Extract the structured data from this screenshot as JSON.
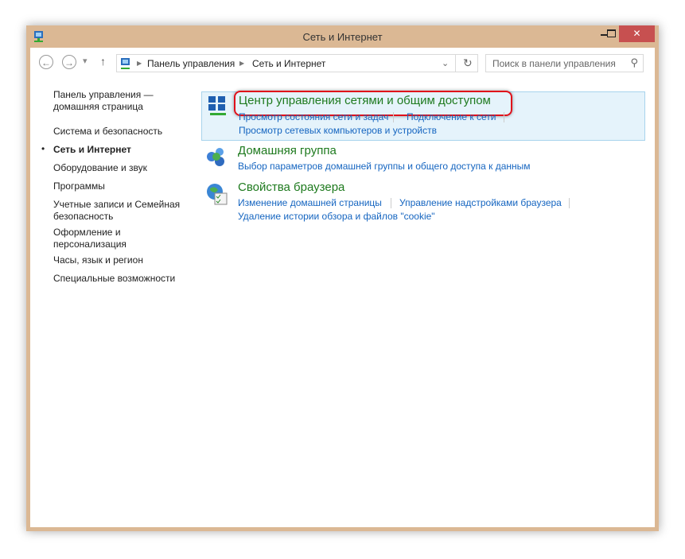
{
  "window": {
    "title": "Сеть и Интернет",
    "close": "✕"
  },
  "nav": {
    "back": "←",
    "forward": "→",
    "up": "↑",
    "dropdown": "▾",
    "refresh": "↻",
    "breadcrumb": [
      "Панель управления",
      "Сеть и Интернет"
    ],
    "search_placeholder": "Поиск в панели управления"
  },
  "sidebar": {
    "home": "Панель управления — домашняя страница",
    "items": [
      "Система и безопасность",
      "Сеть и Интернет",
      "Оборудование и звук",
      "Программы",
      "Учетные записи и Семейная безопасность",
      "Оформление и персонализация",
      "Часы, язык и регион",
      "Специальные возможности"
    ],
    "active": "Сеть и Интернет"
  },
  "categories": [
    {
      "title": "Центр управления сетями и общим доступом",
      "links": [
        "Просмотр состояния сети и задач",
        "Подключение к сети",
        "Просмотр сетевых компьютеров и устройств"
      ]
    },
    {
      "title": "Домашняя группа",
      "links": [
        "Выбор параметров домашней группы и общего доступа к данным"
      ]
    },
    {
      "title": "Свойства браузера",
      "links": [
        "Изменение домашней страницы",
        "Управление надстройками браузера",
        "Удаление истории обзора и файлов \"cookie\""
      ]
    }
  ],
  "colors": {
    "frame": "#dbb894",
    "close": "#c75050",
    "highlight": "#e0101a",
    "title_green": "#1e7a1e",
    "link_blue": "#1565c0"
  }
}
